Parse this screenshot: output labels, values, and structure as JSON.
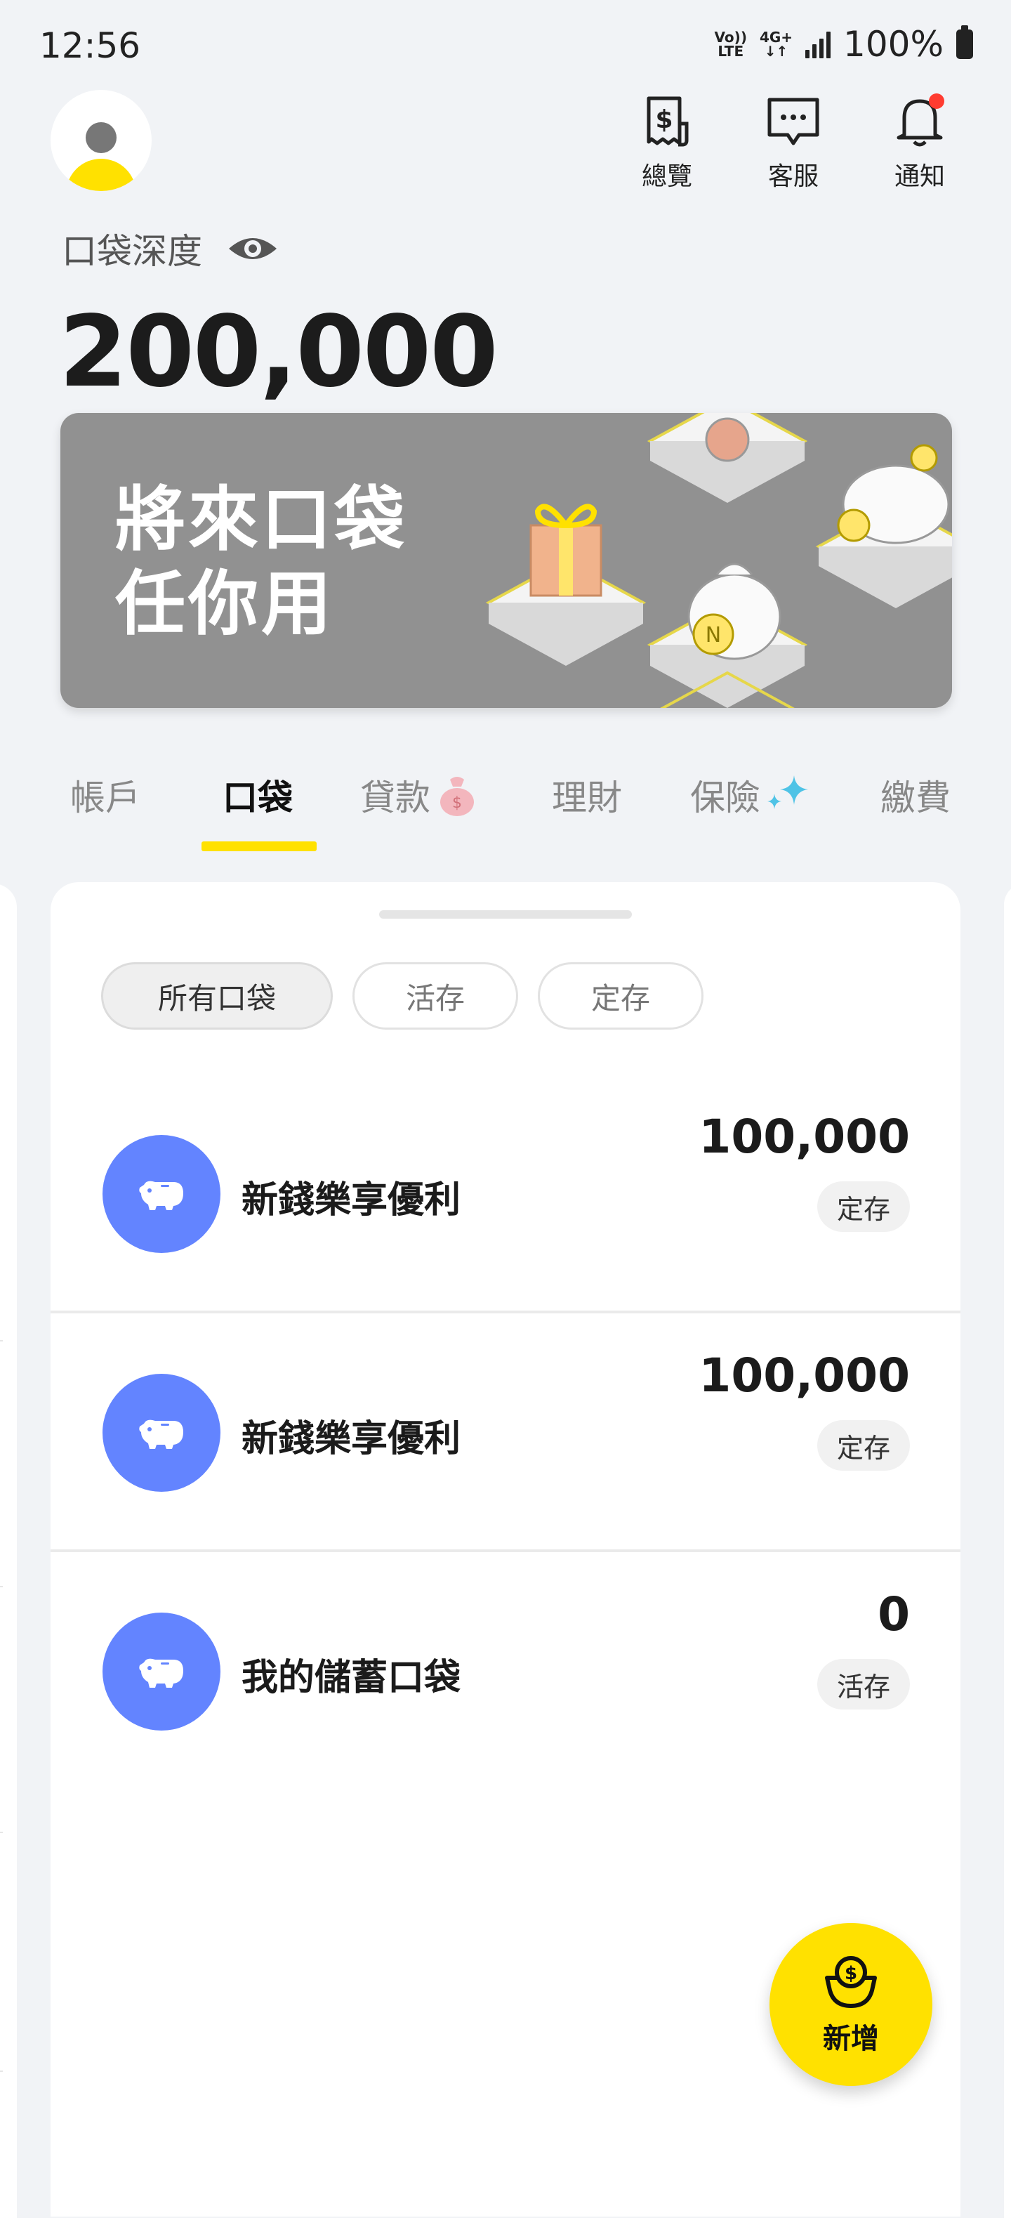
{
  "status_bar": {
    "time": "12:56",
    "volte": "Vo)) LTE",
    "network": "4G+",
    "battery": "100%"
  },
  "header": {
    "actions": [
      {
        "label": "總覽",
        "icon": "receipt-dollar-icon"
      },
      {
        "label": "客服",
        "icon": "chat-bubble-icon"
      },
      {
        "label": "通知",
        "icon": "bell-icon"
      }
    ],
    "balance_label": "口袋深度",
    "balance_amount": "200,000"
  },
  "banner": {
    "line1": "將來口袋",
    "line2": "任你用"
  },
  "tabs": [
    {
      "label": "帳戶",
      "active": false
    },
    {
      "label": "口袋",
      "active": true
    },
    {
      "label": "貸款",
      "active": false,
      "icon": "money-bag-icon"
    },
    {
      "label": "理財",
      "active": false
    },
    {
      "label": "保險",
      "active": false,
      "icon": "sparkle-icon"
    },
    {
      "label": "繳費",
      "active": false
    }
  ],
  "filters": [
    {
      "label": "所有口袋",
      "active": true
    },
    {
      "label": "活存",
      "active": false
    },
    {
      "label": "定存",
      "active": false
    }
  ],
  "pockets": [
    {
      "name": "新錢樂享優利",
      "amount": "100,000",
      "type": "定存"
    },
    {
      "name": "新錢樂享優利",
      "amount": "100,000",
      "type": "定存"
    },
    {
      "name": "我的儲蓄口袋",
      "amount": "0",
      "type": "活存"
    }
  ],
  "fab": {
    "label": "新增"
  },
  "colors": {
    "accent": "#ffe100",
    "pocket_icon": "#6384ff",
    "background": "#f1f3f6"
  }
}
